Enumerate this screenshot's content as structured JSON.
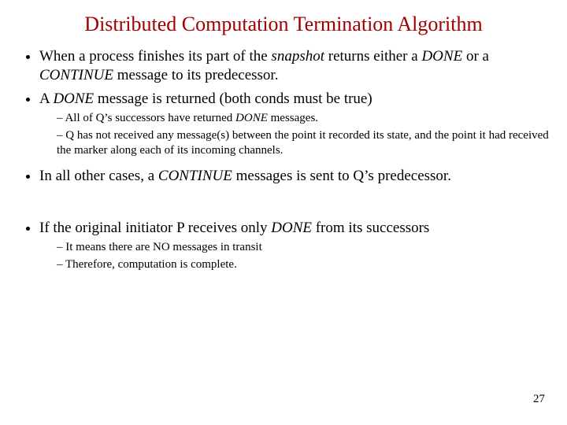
{
  "title": "Distributed Computation Termination Algorithm",
  "b1": {
    "pre": "When a process finishes its part of the ",
    "snap": "snapshot",
    "mid1": " returns either a ",
    "done": "DONE",
    "mid2": " or a ",
    "cont": "CONTINUE",
    "post": " message to its predecessor."
  },
  "b2": {
    "pre": "A ",
    "done": "DONE",
    "post": " message is returned (both conds must be true)"
  },
  "b2s1": {
    "pre": "All of Q’s successors have returned ",
    "done": "DONE",
    "post": " messages."
  },
  "b2s2": "Q has not received any message(s) between the point it recorded its state, and the point it had received the marker along each of its incoming channels.",
  "b3": {
    "pre": "In all other cases, a ",
    "cont": "CONTINUE",
    "post": " messages is sent to Q’s predecessor."
  },
  "b4": {
    "pre": "If the original initiator P receives only ",
    "done": "DONE",
    "post": " from its successors"
  },
  "b4s1": "It means there are NO messages in transit",
  "b4s2": "Therefore, computation is complete.",
  "page": "27"
}
